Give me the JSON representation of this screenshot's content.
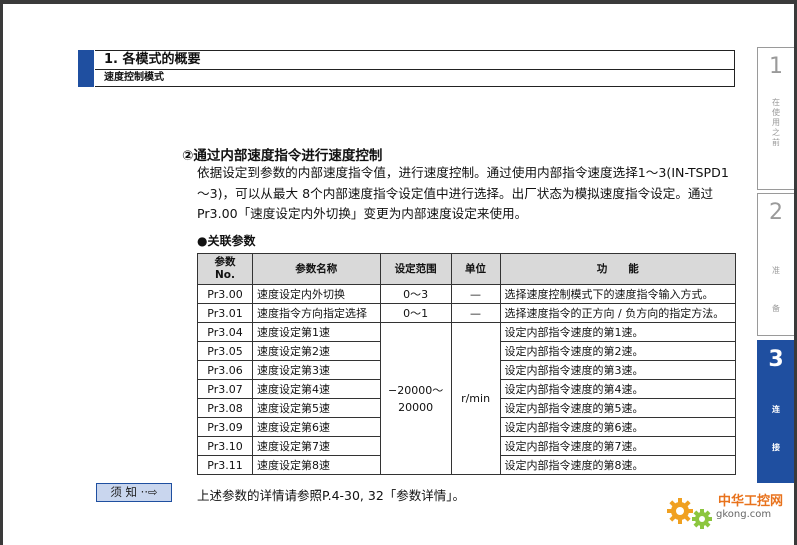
{
  "header": {
    "title": "1. 各模式的概要",
    "subtitle": "速度控制模式"
  },
  "side_tabs": [
    {
      "number": "1",
      "label": "在\n使\n用\n之\n前"
    },
    {
      "number": "2",
      "label": "准\n备"
    },
    {
      "number": "3",
      "label": "连\n接"
    }
  ],
  "section": {
    "title": "②通过内部速度指令进行速度控制",
    "paragraph": "依据设定到参数的内部速度指令值，进行速度控制。通过使用内部指令速度选择1～3(IN-TSPD1～3)，可以从最大 8个内部速度指令设定值中进行选择。出厂状态为模拟速度指令设定。通过Pr3.00「速度设定内外切换」变更为内部速度设定来使用。",
    "related_title": "●关联参数"
  },
  "table": {
    "headers": {
      "no": "参数\nNo.",
      "name": "参数名称",
      "range": "设定范围",
      "unit": "单位",
      "func": "功　　能"
    },
    "rows": [
      {
        "no": "Pr3.00",
        "name": "速度设定内外切换",
        "range": "0～3",
        "unit": "—",
        "func": "选择速度控制模式下的速度指令输入方式。"
      },
      {
        "no": "Pr3.01",
        "name": "速度指令方向指定选择",
        "range": "0～1",
        "unit": "—",
        "func": "选择速度指令的正方向 / 负方向的指定方法。"
      },
      {
        "no": "Pr3.04",
        "name": "速度设定第1速",
        "func": "设定内部指令速度的第1速。"
      },
      {
        "no": "Pr3.05",
        "name": "速度设定第2速",
        "func": "设定内部指令速度的第2速。"
      },
      {
        "no": "Pr3.06",
        "name": "速度设定第3速",
        "func": "设定内部指令速度的第3速。"
      },
      {
        "no": "Pr3.07",
        "name": "速度设定第4速",
        "func": "设定内部指令速度的第4速。"
      },
      {
        "no": "Pr3.08",
        "name": "速度设定第5速",
        "func": "设定内部指令速度的第5速。"
      },
      {
        "no": "Pr3.09",
        "name": "速度设定第6速",
        "func": "设定内部指令速度的第6速。"
      },
      {
        "no": "Pr3.10",
        "name": "速度设定第7速",
        "func": "设定内部指令速度的第7速。"
      },
      {
        "no": "Pr3.11",
        "name": "速度设定第8速",
        "func": "设定内部指令速度的第8速。"
      }
    ],
    "merged_range": "−20000～\n20000",
    "merged_unit": "r/min"
  },
  "note": {
    "button_label": "须 知 ··⇨",
    "text": "上述参数的详情请参照P.4-30, 32「参数详情」。"
  },
  "watermark": {
    "name": "中华工控网",
    "url": "gkong.com"
  },
  "colors": {
    "accent_blue": "#1f4fa0",
    "header_gray": "#d9d9d9",
    "note_fill": "#c9d6ee",
    "watermark_orange": "#e8721c"
  }
}
